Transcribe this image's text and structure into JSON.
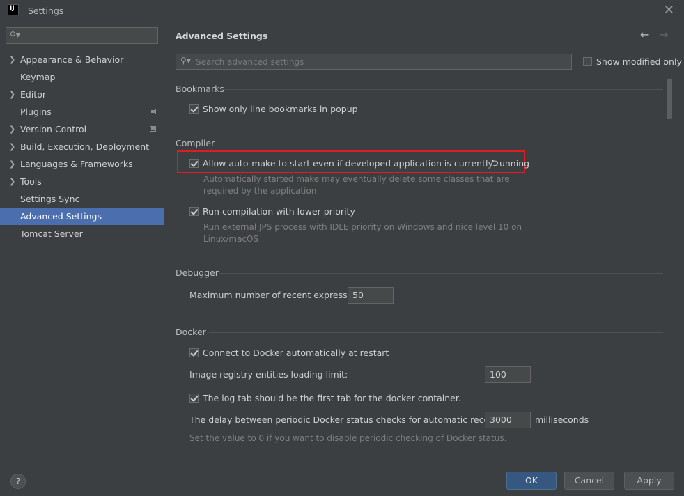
{
  "window": {
    "title": "Settings",
    "logo_text": "IJ"
  },
  "sidebar": {
    "search_placeholder": "",
    "items": [
      {
        "label": "Appearance & Behavior",
        "expandable": true,
        "project_icon": false,
        "selected": false
      },
      {
        "label": "Keymap",
        "expandable": false,
        "project_icon": false,
        "selected": false
      },
      {
        "label": "Editor",
        "expandable": true,
        "project_icon": false,
        "selected": false
      },
      {
        "label": "Plugins",
        "expandable": false,
        "project_icon": true,
        "selected": false
      },
      {
        "label": "Version Control",
        "expandable": true,
        "project_icon": true,
        "selected": false
      },
      {
        "label": "Build, Execution, Deployment",
        "expandable": true,
        "project_icon": false,
        "selected": false
      },
      {
        "label": "Languages & Frameworks",
        "expandable": true,
        "project_icon": false,
        "selected": false
      },
      {
        "label": "Tools",
        "expandable": true,
        "project_icon": false,
        "selected": false
      },
      {
        "label": "Settings Sync",
        "expandable": false,
        "project_icon": false,
        "selected": false
      },
      {
        "label": "Advanced Settings",
        "expandable": false,
        "project_icon": false,
        "selected": true
      },
      {
        "label": "Tomcat Server",
        "expandable": false,
        "project_icon": false,
        "selected": false
      }
    ]
  },
  "main": {
    "title": "Advanced Settings",
    "search_placeholder": "Search advanced settings",
    "show_modified_label": "Show modified only",
    "show_modified_checked": false,
    "sections": {
      "bookmarks": {
        "title": "Bookmarks",
        "line_bookmarks_label": "Show only line bookmarks in popup",
        "line_bookmarks_checked": true
      },
      "compiler": {
        "title": "Compiler",
        "auto_make_label": "Allow auto-make to start even if developed application is currently running",
        "auto_make_checked": true,
        "auto_make_desc": "Automatically started make may eventually delete some classes that are required by the application",
        "lower_priority_label": "Run compilation with lower priority",
        "lower_priority_checked": true,
        "lower_priority_desc": "Run external JPS process with IDLE priority on Windows and nice level 10 on Linux/macOS"
      },
      "debugger": {
        "title": "Debugger",
        "recent_expr_label": "Maximum number of recent expressions:",
        "recent_expr_value": "50"
      },
      "docker": {
        "title": "Docker",
        "auto_connect_label": "Connect to Docker automatically at restart",
        "auto_connect_checked": true,
        "registry_limit_label": "Image registry entities loading limit:",
        "registry_limit_value": "100",
        "log_tab_label": "The log tab should be the first tab for the docker container.",
        "log_tab_checked": true,
        "delay_label": "The delay between periodic Docker status checks for automatic reconnection:",
        "delay_value": "3000",
        "delay_unit": "milliseconds",
        "delay_hint": "Set the value to 0 if you want to disable periodic checking of Docker status."
      }
    }
  },
  "footer": {
    "help_label": "?",
    "ok_label": "OK",
    "cancel_label": "Cancel",
    "apply_label": "Apply"
  },
  "colors": {
    "background": "#3c3f41",
    "selection": "#4b6eaf",
    "highlight_box": "#e01b24",
    "ok_button": "#365880"
  }
}
